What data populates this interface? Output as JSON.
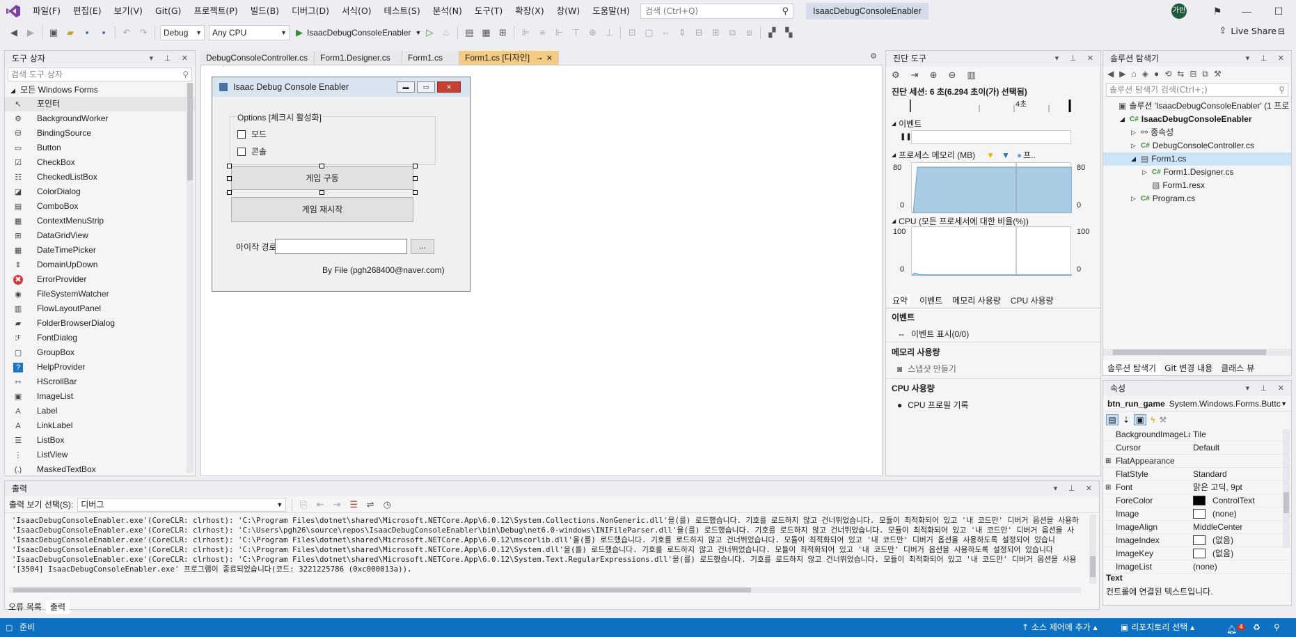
{
  "titlebar": {
    "menu": [
      "파일(F)",
      "편집(E)",
      "보기(V)",
      "Git(G)",
      "프로젝트(P)",
      "빌드(B)",
      "디버그(D)",
      "서식(O)",
      "테스트(S)",
      "분석(N)",
      "도구(T)",
      "확장(X)",
      "창(W)",
      "도움말(H)"
    ],
    "search_placeholder": "검색 (Ctrl+Q)",
    "project_name": "IsaacDebugConsoleEnabler",
    "avatar_initials": "가빈"
  },
  "toolbar": {
    "config": "Debug",
    "platform": "Any CPU",
    "start_target": "IsaacDebugConsoleEnabler",
    "live_share": "Live Share"
  },
  "toolbox": {
    "title": "도구 상자",
    "search_placeholder": "검색 도구 상자",
    "group": "모든 Windows Forms",
    "items": [
      {
        "icon": "pointer-icon",
        "label": "포인터"
      },
      {
        "icon": "background-worker-icon",
        "label": "BackgroundWorker"
      },
      {
        "icon": "binding-source-icon",
        "label": "BindingSource"
      },
      {
        "icon": "button-icon",
        "label": "Button"
      },
      {
        "icon": "checkbox-icon",
        "label": "CheckBox"
      },
      {
        "icon": "checked-listbox-icon",
        "label": "CheckedListBox"
      },
      {
        "icon": "color-dialog-icon",
        "label": "ColorDialog"
      },
      {
        "icon": "combobox-icon",
        "label": "ComboBox"
      },
      {
        "icon": "context-menu-icon",
        "label": "ContextMenuStrip"
      },
      {
        "icon": "datagridview-icon",
        "label": "DataGridView"
      },
      {
        "icon": "datetimepicker-icon",
        "label": "DateTimePicker"
      },
      {
        "icon": "domain-updown-icon",
        "label": "DomainUpDown"
      },
      {
        "icon": "error-provider-icon",
        "label": "ErrorProvider"
      },
      {
        "icon": "filesystem-watcher-icon",
        "label": "FileSystemWatcher"
      },
      {
        "icon": "flow-layout-icon",
        "label": "FlowLayoutPanel"
      },
      {
        "icon": "folder-dialog-icon",
        "label": "FolderBrowserDialog"
      },
      {
        "icon": "font-dialog-icon",
        "label": "FontDialog"
      },
      {
        "icon": "groupbox-icon",
        "label": "GroupBox"
      },
      {
        "icon": "help-provider-icon",
        "label": "HelpProvider"
      },
      {
        "icon": "hscrollbar-icon",
        "label": "HScrollBar"
      },
      {
        "icon": "imagelist-icon",
        "label": "ImageList"
      },
      {
        "icon": "label-icon",
        "label": "Label"
      },
      {
        "icon": "linklabel-icon",
        "label": "LinkLabel"
      },
      {
        "icon": "listbox-icon",
        "label": "ListBox"
      },
      {
        "icon": "listview-icon",
        "label": "ListView"
      },
      {
        "icon": "maskedtextbox-icon",
        "label": "MaskedTextBox"
      }
    ]
  },
  "doc_tabs": [
    {
      "label": "DebugConsoleController.cs",
      "active": false
    },
    {
      "label": "Form1.Designer.cs",
      "active": false
    },
    {
      "label": "Form1.cs",
      "active": false
    },
    {
      "label": "Form1.cs [디자인]",
      "active": true
    }
  ],
  "form": {
    "title": "Isaac Debug Console Enabler",
    "group_title": "Options [체크시 활성화]",
    "check_mod": "모드",
    "check_console": "콘솔",
    "btn_run": "게임 구동",
    "btn_restart": "게임 재시작",
    "path_label": "아이작 경로",
    "browse_button": "...",
    "credit": "By File (pgh268400@naver.com)"
  },
  "diagnostics": {
    "title": "진단 도구",
    "session": "진단 세션: 6 초(6.294 초이(가) 선택됨)",
    "timeline_label": "4초",
    "events_label": "이벤트",
    "memory_label": "프로세스 메모리 (MB)",
    "memory_legend": "프..",
    "mem_max": "80",
    "mem_min": "0",
    "cpu_label": "CPU (모든 프로세서에 대한 비율(%))",
    "cpu_max": "100",
    "cpu_min": "0",
    "tabs": [
      "요약",
      "이벤트",
      "메모리 사용량",
      "CPU 사용량"
    ],
    "section_events": "이벤트",
    "show_events": "이벤트 표시(0/0)",
    "section_memory": "메모리 사용량",
    "snapshot": "스냅샷 만들기",
    "section_cpu": "CPU 사용량",
    "cpu_record": "CPU 프로필 기록"
  },
  "solution_explorer": {
    "title": "솔루션 탐색기",
    "search_placeholder": "솔루션 탐색기 검색(Ctrl+;)",
    "items": [
      {
        "label": "솔루션 'IsaacDebugConsoleEnabler' (1 프로",
        "indent": 0,
        "bold": false,
        "cs": false,
        "expander": ""
      },
      {
        "label": "IsaacDebugConsoleEnabler",
        "indent": 1,
        "bold": true,
        "cs": true,
        "expander": "◢"
      },
      {
        "label": "종속성",
        "indent": 2,
        "bold": false,
        "cs": false,
        "expander": "▷"
      },
      {
        "label": "DebugConsoleController.cs",
        "indent": 2,
        "bold": false,
        "cs": true,
        "expander": "▷"
      },
      {
        "label": "Form1.cs",
        "indent": 2,
        "bold": false,
        "cs": false,
        "expander": "◢",
        "selected": true
      },
      {
        "label": "Form1.Designer.cs",
        "indent": 3,
        "bold": false,
        "cs": true,
        "expander": "▷"
      },
      {
        "label": "Form1.resx",
        "indent": 3,
        "bold": false,
        "cs": false,
        "expander": ""
      },
      {
        "label": "Program.cs",
        "indent": 2,
        "bold": false,
        "cs": true,
        "expander": "▷"
      }
    ],
    "bottom_tabs": [
      "솔루션 탐색기",
      "Git 변경 내용",
      "클래스 뷰"
    ]
  },
  "properties": {
    "title": "속성",
    "object": "btn_run_game",
    "object_type": "System.Windows.Forms.Buttc",
    "rows": [
      {
        "name": "BackgroundImageLa",
        "value": "Tile",
        "swatch": "",
        "expand": false
      },
      {
        "name": "Cursor",
        "value": "Default",
        "swatch": "",
        "expand": false
      },
      {
        "name": "FlatAppearance",
        "value": "",
        "swatch": "",
        "expand": true
      },
      {
        "name": "FlatStyle",
        "value": "Standard",
        "swatch": "",
        "expand": false
      },
      {
        "name": "Font",
        "value": "맑은 고딕, 9pt",
        "swatch": "",
        "expand": true
      },
      {
        "name": "ForeColor",
        "value": "ControlText",
        "swatch": "#000000",
        "expand": false
      },
      {
        "name": "Image",
        "value": "(none)",
        "swatch": "#ffffff",
        "expand": false
      },
      {
        "name": "ImageAlign",
        "value": "MiddleCenter",
        "swatch": "",
        "expand": false
      },
      {
        "name": "ImageIndex",
        "value": "(없음)",
        "swatch": "#ffffff",
        "expand": false
      },
      {
        "name": "ImageKey",
        "value": "(없음)",
        "swatch": "#ffffff",
        "expand": false
      },
      {
        "name": "ImageList",
        "value": "(none)",
        "swatch": "",
        "expand": false
      }
    ],
    "desc_title": "Text",
    "desc_text": "컨트롤에 연결된 텍스트입니다."
  },
  "output": {
    "title": "출력",
    "source_label": "출력 보기 선택(S):",
    "source_value": "디버그",
    "lines": [
      "'IsaacDebugConsoleEnabler.exe'(CoreCLR: clrhost): 'C:\\Program Files\\dotnet\\shared\\Microsoft.NETCore.App\\6.0.12\\System.Collections.NonGeneric.dll'을(를) 로드했습니다. 기호를 로드하지 않고 건너뛰었습니다. 모듈이 최적화되어 있고 '내 코드만' 디버거 옵션을 사용하",
      "'IsaacDebugConsoleEnabler.exe'(CoreCLR: clrhost): 'C:\\Users\\pgh26\\source\\repos\\IsaacDebugConsoleEnabler\\bin\\Debug\\net6.0-windows\\INIFileParser.dll'을(를) 로드했습니다. 기호를 로드하지 않고 건너뛰었습니다. 모듈이 최적화되어 있고 '내 코드만' 디버거 옵션을 사",
      "'IsaacDebugConsoleEnabler.exe'(CoreCLR: clrhost): 'C:\\Program Files\\dotnet\\shared\\Microsoft.NETCore.App\\6.0.12\\mscorlib.dll'을(를) 로드했습니다. 기호를 로드하지 않고 건너뛰었습니다. 모듈이 최적화되어 있고 '내 코드만' 디버거 옵션을 사용하도록 설정되어 있습니",
      "'IsaacDebugConsoleEnabler.exe'(CoreCLR: clrhost): 'C:\\Program Files\\dotnet\\shared\\Microsoft.NETCore.App\\6.0.12\\System.dll'을(를) 로드했습니다. 기호를 로드하지 않고 건너뛰었습니다. 모듈이 최적화되어 있고 '내 코드만' 디버거 옵션을 사용하도록 설정되어 있습니다",
      "'IsaacDebugConsoleEnabler.exe'(CoreCLR: clrhost): 'C:\\Program Files\\dotnet\\shared\\Microsoft.NETCore.App\\6.0.12\\System.Text.RegularExpressions.dll'을(를) 로드했습니다. 기호를 로드하지 않고 건너뛰었습니다. 모듈이 최적화되어 있고 '내 코드만' 디버거 옵션을 사용",
      "'[3504] IsaacDebugConsoleEnabler.exe' 프로그램이 종료되었습니다(코드: 3221225786 (0xc000013a))."
    ],
    "bottom_tabs": [
      "오류 목록",
      "출력"
    ]
  },
  "statusbar": {
    "status": "준비",
    "source_control": "소스 제어에 추가",
    "repo": "리포지토리 선택",
    "notifications": "4"
  }
}
